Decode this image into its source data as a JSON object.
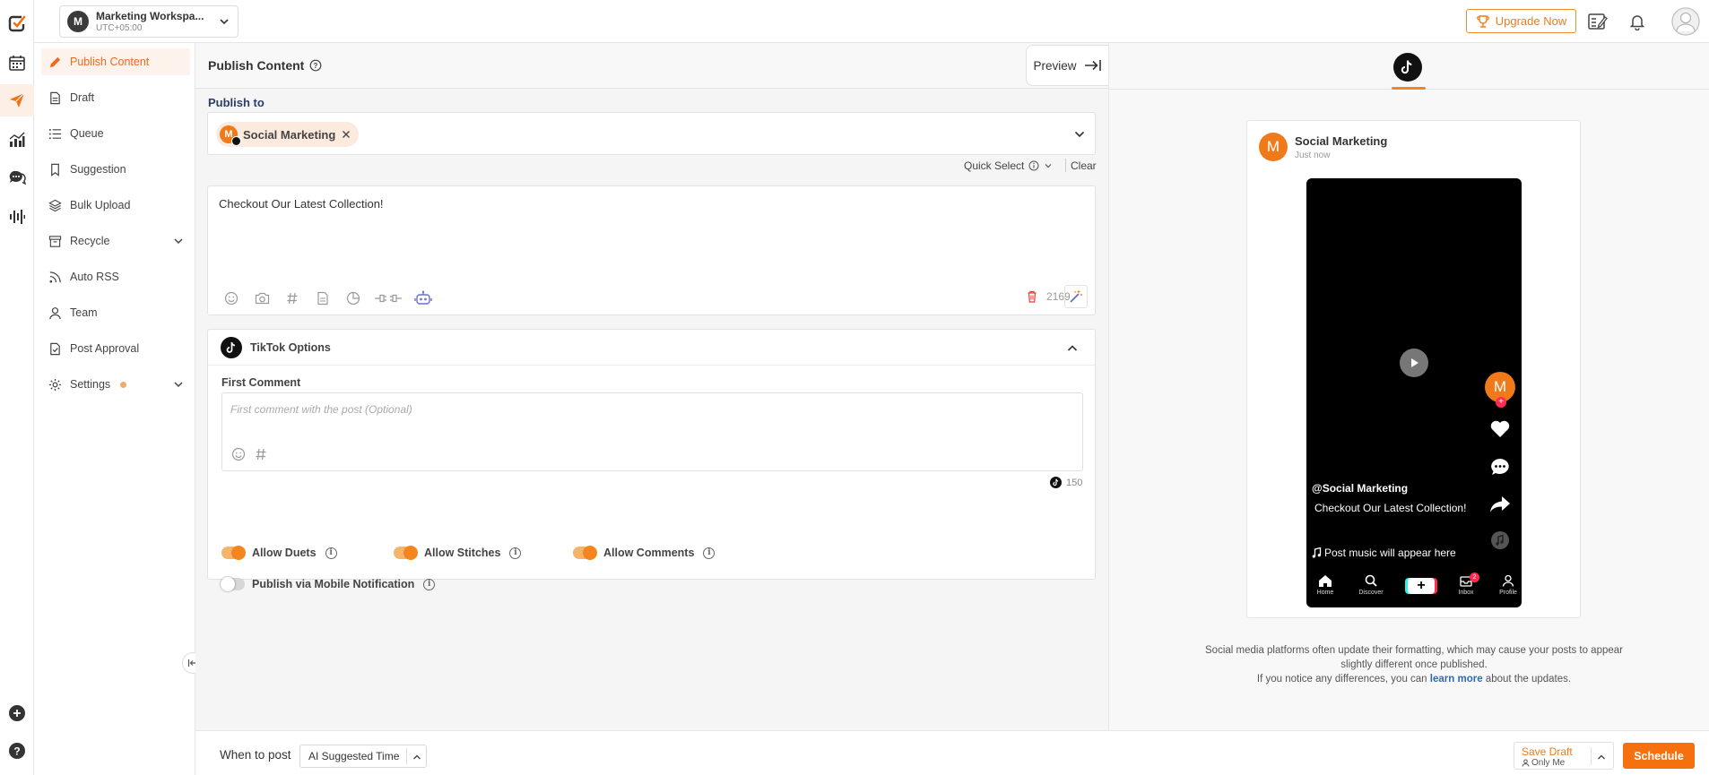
{
  "workspace": {
    "avatar": "M",
    "name": "Marketing Workspa...",
    "timezone": "UTC+05:00"
  },
  "topbar": {
    "upgrade_label": "Upgrade Now"
  },
  "sidebar": {
    "items": [
      {
        "label": "Publish Content",
        "icon": "pencil-icon"
      },
      {
        "label": "Draft",
        "icon": "file-icon"
      },
      {
        "label": "Queue",
        "icon": "list-icon"
      },
      {
        "label": "Suggestion",
        "icon": "bookmark-icon"
      },
      {
        "label": "Bulk Upload",
        "icon": "layers-icon"
      },
      {
        "label": "Recycle",
        "icon": "archive-icon"
      },
      {
        "label": "Auto RSS",
        "icon": "rss-icon"
      },
      {
        "label": "Team",
        "icon": "user-icon"
      },
      {
        "label": "Post Approval",
        "icon": "approval-icon"
      },
      {
        "label": "Settings",
        "icon": "gear-icon"
      }
    ]
  },
  "main": {
    "title": "Publish Content",
    "preview_label": "Preview",
    "publish_to_label": "Publish to",
    "account_chip": {
      "avatar": "M",
      "name": "Social Marketing"
    },
    "quick_select": "Quick Select",
    "clear": "Clear",
    "post_text": "Checkout Our Latest Collection!",
    "char_count": "2169",
    "tiktok_options_title": "TikTok Options",
    "first_comment_label": "First Comment",
    "first_comment_placeholder": "First comment with the post (Optional)",
    "first_comment_count": "150",
    "toggles": {
      "duets": {
        "label": "Allow Duets",
        "on": true
      },
      "stitches": {
        "label": "Allow Stitches",
        "on": true
      },
      "comments": {
        "label": "Allow Comments",
        "on": true
      },
      "mobile": {
        "label": "Publish via Mobile Notification",
        "on": false
      }
    }
  },
  "preview": {
    "account_name": "Social Marketing",
    "avatar": "M",
    "time": "Just now",
    "handle": "@Social Marketing",
    "caption": "Checkout Our Latest Collection!",
    "music": "Post music will appear here",
    "nav": [
      "Home",
      "Discover",
      "Inbox",
      "Profile"
    ],
    "inbox_badge": "2",
    "note_line1": "Social media platforms often update their formatting, which may cause your posts to appear slightly different once published.",
    "note_line2_a": "If you notice any differences, you can",
    "note_link": "learn more",
    "note_line2_b": "about the updates."
  },
  "bottom": {
    "when_label": "When to post",
    "when_value": "AI Suggested Time",
    "save_draft": "Save Draft",
    "save_draft_sub": "Only Me",
    "schedule": "Schedule"
  },
  "colors": {
    "accent": "#f5700f",
    "link": "#2d6bb5",
    "brand_text": "#2c3e66"
  }
}
